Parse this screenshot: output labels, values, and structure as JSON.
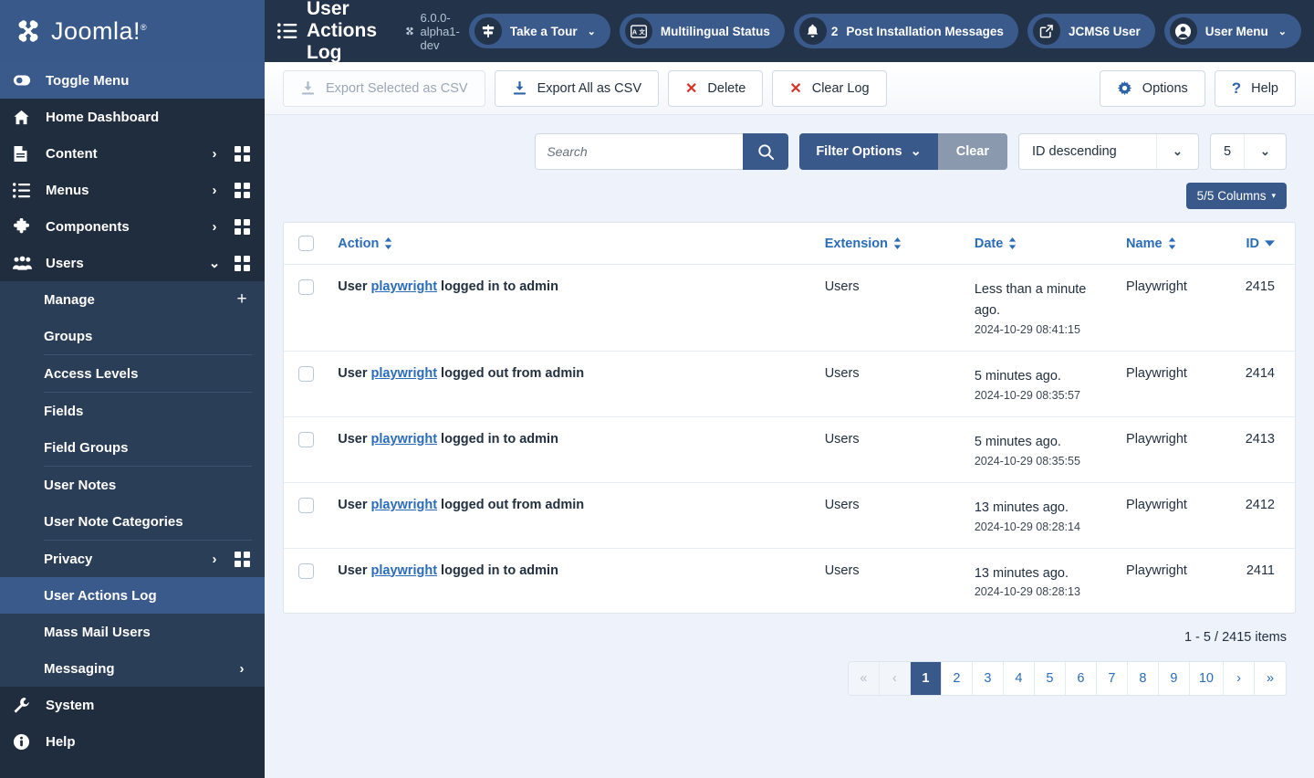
{
  "brand": {
    "name": "Joomla!",
    "logo_icon": "joomla-logo-icon",
    "reg": "®"
  },
  "toggle_menu": {
    "label": "Toggle Menu",
    "icon": "toggle-switch-icon"
  },
  "sidebar": {
    "items": [
      {
        "label": "Home Dashboard",
        "icon": "home-icon",
        "has_chevron": false,
        "has_grid": false
      },
      {
        "label": "Content",
        "icon": "document-icon",
        "has_chevron": true,
        "chevron": "›",
        "has_grid": true
      },
      {
        "label": "Menus",
        "icon": "list-icon",
        "has_chevron": true,
        "chevron": "›",
        "has_grid": true
      },
      {
        "label": "Components",
        "icon": "puzzle-icon",
        "has_chevron": true,
        "chevron": "›",
        "has_grid": true
      },
      {
        "label": "Users",
        "icon": "users-icon",
        "has_chevron": true,
        "chevron": "⌄",
        "has_grid": true,
        "expanded": true
      }
    ],
    "users_submenu": [
      {
        "label": "Manage",
        "suffix": "plus",
        "plus": "+"
      },
      {
        "label": "Groups",
        "suffix": "none"
      },
      {
        "separator_after": true,
        "label": "Access Levels",
        "suffix": "none"
      },
      {
        "label": "Fields",
        "suffix": "none"
      },
      {
        "label": "Field Groups",
        "suffix": "none"
      },
      {
        "label": "User Notes",
        "suffix": "none"
      },
      {
        "label": "User Note Categories",
        "suffix": "none"
      },
      {
        "label": "Privacy",
        "suffix": "chevron-grid",
        "chevron": "›"
      },
      {
        "label": "User Actions Log",
        "suffix": "none",
        "active": true
      },
      {
        "label": "Mass Mail Users",
        "suffix": "none"
      },
      {
        "label": "Messaging",
        "suffix": "chevron",
        "chevron": "›"
      }
    ],
    "bottom_items": [
      {
        "label": "System",
        "icon": "wrench-icon"
      },
      {
        "label": "Help",
        "icon": "info-circle-icon"
      }
    ]
  },
  "header": {
    "title": "User Actions Log",
    "title_icon": "list-icon",
    "version": "6.0.0-alpha1-dev",
    "version_icon": "joomla-mark-icon",
    "take_a_tour": {
      "label": "Take a Tour",
      "icon": "signpost-icon",
      "caret": "⌄"
    },
    "multilingual": {
      "label": "Multilingual Status",
      "icon": "translate-icon"
    },
    "messages": {
      "label": "Post Installation Messages",
      "icon": "bell-icon",
      "count": "2"
    },
    "site": {
      "label": "JCMS6 User",
      "icon": "external-link-icon"
    },
    "user_menu": {
      "label": "User Menu",
      "icon": "user-circle-icon",
      "caret": "⌄"
    }
  },
  "toolbar": {
    "export_selected": {
      "label": "Export Selected as CSV",
      "icon": "download-icon",
      "disabled": true
    },
    "export_all": {
      "label": "Export All as CSV",
      "icon": "download-icon",
      "disabled": false
    },
    "delete": {
      "label": "Delete",
      "icon": "x-icon"
    },
    "clear_log": {
      "label": "Clear Log",
      "icon": "x-icon"
    },
    "options": {
      "label": "Options",
      "icon": "gear-icon"
    },
    "help": {
      "label": "Help",
      "icon": "question-icon"
    }
  },
  "filters": {
    "search_placeholder": "Search",
    "search_value": "",
    "search_icon": "search-icon",
    "filter_options": {
      "label": "Filter Options",
      "caret": "⌄"
    },
    "clear": {
      "label": "Clear"
    },
    "ordering": {
      "value": "ID descending",
      "caret": "⌄"
    },
    "limit": {
      "value": "5",
      "caret": "⌄"
    },
    "columns": {
      "label": "5/5 Columns",
      "caret": "▾"
    }
  },
  "table": {
    "select_all_label": "select-all",
    "columns": [
      {
        "key": "action",
        "label": "Action",
        "sort": "both"
      },
      {
        "key": "extension",
        "label": "Extension",
        "sort": "both"
      },
      {
        "key": "date",
        "label": "Date",
        "sort": "both"
      },
      {
        "key": "name",
        "label": "Name",
        "sort": "both"
      },
      {
        "key": "id",
        "label": "ID",
        "sort": "desc"
      }
    ],
    "rows": [
      {
        "action_prefix": "User ",
        "action_link": "playwright",
        "action_suffix": " logged in to admin",
        "extension": "Users",
        "date_relative": "Less than a minute ago.",
        "date_absolute": "2024-10-29 08:41:15",
        "name": "Playwright",
        "id": "2415"
      },
      {
        "action_prefix": "User ",
        "action_link": "playwright",
        "action_suffix": " logged out from admin",
        "extension": "Users",
        "date_relative": "5 minutes ago.",
        "date_absolute": "2024-10-29 08:35:57",
        "name": "Playwright",
        "id": "2414"
      },
      {
        "action_prefix": "User ",
        "action_link": "playwright",
        "action_suffix": " logged in to admin",
        "extension": "Users",
        "date_relative": "5 minutes ago.",
        "date_absolute": "2024-10-29 08:35:55",
        "name": "Playwright",
        "id": "2413"
      },
      {
        "action_prefix": "User ",
        "action_link": "playwright",
        "action_suffix": " logged out from admin",
        "extension": "Users",
        "date_relative": "13 minutes ago.",
        "date_absolute": "2024-10-29 08:28:14",
        "name": "Playwright",
        "id": "2412"
      },
      {
        "action_prefix": "User ",
        "action_link": "playwright",
        "action_suffix": " logged in to admin",
        "extension": "Users",
        "date_relative": "13 minutes ago.",
        "date_absolute": "2024-10-29 08:28:13",
        "name": "Playwright",
        "id": "2411"
      }
    ]
  },
  "footer": {
    "items_count": "1 - 5 / 2415 items",
    "pagination": [
      {
        "label": "«",
        "name": "first-page",
        "disabled": true
      },
      {
        "label": "‹",
        "name": "prev-page",
        "disabled": true
      },
      {
        "label": "1",
        "name": "page-1",
        "active": true
      },
      {
        "label": "2",
        "name": "page-2"
      },
      {
        "label": "3",
        "name": "page-3"
      },
      {
        "label": "4",
        "name": "page-4"
      },
      {
        "label": "5",
        "name": "page-5"
      },
      {
        "label": "6",
        "name": "page-6"
      },
      {
        "label": "7",
        "name": "page-7"
      },
      {
        "label": "8",
        "name": "page-8"
      },
      {
        "label": "9",
        "name": "page-9"
      },
      {
        "label": "10",
        "name": "page-10"
      },
      {
        "label": "›",
        "name": "next-page"
      },
      {
        "label": "»",
        "name": "last-page"
      }
    ]
  },
  "colors": {
    "brand_blue": "#39598a",
    "sidebar_dark": "#1f2d3e",
    "submenu": "#2b3e57",
    "topbar": "#22334a",
    "body_bg": "#eef2fa",
    "link_blue": "#2b6cb9",
    "danger_red": "#d6322a"
  }
}
